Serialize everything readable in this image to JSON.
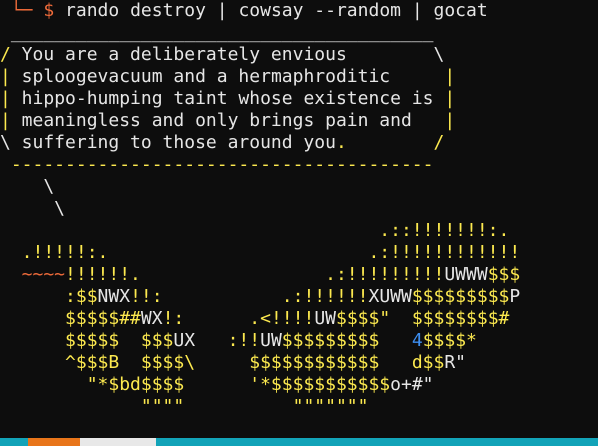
{
  "palette": {
    "white": "#e6e6e6",
    "yellow": "#fce94f",
    "orange": "#ef6b3a",
    "blue": "#3d8ef0",
    "grey": "#bdbdbd",
    "background": "#0d0d0d",
    "status_teal": "#12a3b8",
    "status_orange": "#e8751a"
  },
  "terminal": {
    "prompt_symbol": "$",
    "command": "rando destroy | cowsay --random | gocat",
    "lines": [
      [
        {
          "text": " ",
          "color": "white"
        },
        {
          "text": "└─",
          "color": "orange"
        },
        {
          "text": " $ ",
          "color": "orange"
        },
        {
          "text": "rando destroy | cowsay --random | gocat",
          "color": "white"
        }
      ],
      [
        {
          "text": " _______________________________________",
          "color": "white"
        }
      ],
      [
        {
          "text": "/",
          "color": "yellow"
        },
        {
          "text": " You are a deliberately envious        \\",
          "color": "white"
        }
      ],
      [
        {
          "text": "|",
          "color": "yellow"
        },
        {
          "text": " splooge",
          "color": "white"
        },
        {
          "text": "vacuum and a hermaphroditic    ",
          "color": "white"
        },
        {
          "text": " |",
          "color": "yellow"
        }
      ],
      [
        {
          "text": "|",
          "color": "yellow"
        },
        {
          "text": " hippo-humping taint whose existence is",
          "color": "white"
        },
        {
          "text": " |",
          "color": "yellow"
        }
      ],
      [
        {
          "text": "|",
          "color": "yellow"
        },
        {
          "text": " meaningless and only brings pain and  ",
          "color": "white"
        },
        {
          "text": " |",
          "color": "yellow"
        }
      ],
      [
        {
          "text": "\\ suffering to those around you",
          "color": "white"
        },
        {
          "text": ".",
          "color": "yellow"
        },
        {
          "text": "        /",
          "color": "yellow"
        }
      ],
      [
        {
          "text": " ---------------------------------------",
          "color": "yellow"
        }
      ],
      [
        {
          "text": "    \\",
          "color": "white"
        }
      ],
      [
        {
          "text": "     \\",
          "color": "white"
        }
      ],
      [
        {
          "text": "                                   .::!!!!!!!:.",
          "color": "yellow"
        }
      ],
      [
        {
          "text": "  .!!!!!:.",
          "color": "yellow"
        },
        {
          "text": "                        .:!!!!!!!!!!!!",
          "color": "yellow"
        }
      ],
      [
        {
          "text": "  ~~~~",
          "color": "orange"
        },
        {
          "text": "!!!!!!.",
          "color": "yellow"
        },
        {
          "text": "                 .:!!!!!!!!!",
          "color": "yellow"
        },
        {
          "text": "UWWW",
          "color": "white"
        },
        {
          "text": "$$$",
          "color": "yellow"
        }
      ],
      [
        {
          "text": "      :$$",
          "color": "yellow"
        },
        {
          "text": "NWX",
          "color": "white"
        },
        {
          "text": "!!:",
          "color": "yellow"
        },
        {
          "text": "           .:!!!!!!",
          "color": "yellow"
        },
        {
          "text": "XUWW",
          "color": "white"
        },
        {
          "text": "$$$$$$$$$",
          "color": "yellow"
        },
        {
          "text": "P",
          "color": "white"
        }
      ],
      [
        {
          "text": "      $$$$$##",
          "color": "yellow"
        },
        {
          "text": "WX",
          "color": "white"
        },
        {
          "text": "!:",
          "color": "yellow"
        },
        {
          "text": "      .<!!!!",
          "color": "yellow"
        },
        {
          "text": "UW",
          "color": "white"
        },
        {
          "text": "$$$$\"",
          "color": "yellow"
        },
        {
          "text": "  $$$$$$$$#",
          "color": "yellow"
        }
      ],
      [
        {
          "text": "      $$$$$  $$$",
          "color": "yellow"
        },
        {
          "text": "UX",
          "color": "white"
        },
        {
          "text": "   :!!",
          "color": "yellow"
        },
        {
          "text": "UW",
          "color": "white"
        },
        {
          "text": "$$$$$$$$$   ",
          "color": "yellow"
        },
        {
          "text": "4",
          "color": "blue"
        },
        {
          "text": "$$$$*",
          "color": "yellow"
        }
      ],
      [
        {
          "text": "      ^$$$B  $$$$\\",
          "color": "yellow"
        },
        {
          "text": "     $$$$$$$$$$$$   ",
          "color": "yellow"
        },
        {
          "text": "d$$",
          "color": "yellow"
        },
        {
          "text": "R\"",
          "color": "white"
        }
      ],
      [
        {
          "text": "        \"*$bd$$$$",
          "color": "yellow"
        },
        {
          "text": "      '*$$$$$$$$$$$",
          "color": "yellow"
        },
        {
          "text": "o+#\"",
          "color": "white"
        }
      ],
      [
        {
          "text": "             \"\"\"\"",
          "color": "yellow"
        },
        {
          "text": "          \"\"\"\"\"\"\"",
          "color": "yellow"
        }
      ]
    ]
  }
}
